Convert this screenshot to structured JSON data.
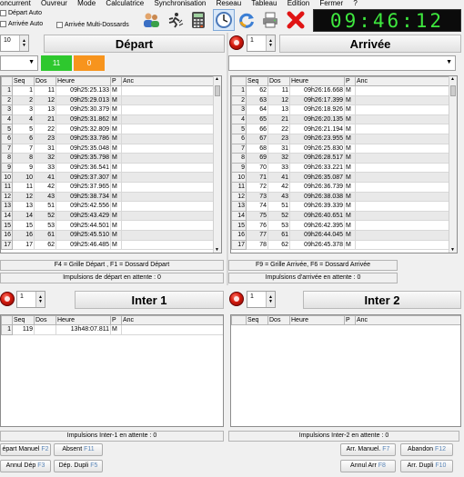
{
  "menu": [
    "oncurrent",
    "Ouvreur",
    "Mode",
    "Calculatrice",
    "Synchronisation",
    "Reseau",
    "Tableau",
    "Edition",
    "Fermer",
    "?"
  ],
  "toolbar": {
    "depart_auto": "Départ Auto",
    "arrivee_auto": "Arrivée Auto",
    "multi_dossards": "Arrivée Multi-Dossards",
    "clock": "09:46:12"
  },
  "depart": {
    "spin": "10",
    "title": "Départ",
    "badge_green": "11",
    "badge_orange": "0",
    "columns": [
      "Seq",
      "Dos",
      "Heure",
      "P",
      "Anc"
    ],
    "rows": [
      [
        "1",
        "1",
        "11",
        "09h25:25.133",
        "M"
      ],
      [
        "2",
        "2",
        "12",
        "09h25:29.013",
        "M"
      ],
      [
        "3",
        "3",
        "13",
        "09h25:30.379",
        "M"
      ],
      [
        "4",
        "4",
        "21",
        "09h25:31.862",
        "M"
      ],
      [
        "5",
        "5",
        "22",
        "09h25:32.809",
        "M"
      ],
      [
        "6",
        "6",
        "23",
        "09h25:33.786",
        "M"
      ],
      [
        "7",
        "7",
        "31",
        "09h25:35.048",
        "M"
      ],
      [
        "8",
        "8",
        "32",
        "09h25:35.798",
        "M"
      ],
      [
        "9",
        "9",
        "33",
        "09h25:36.541",
        "M"
      ],
      [
        "10",
        "10",
        "41",
        "09h25:37.307",
        "M"
      ],
      [
        "11",
        "11",
        "42",
        "09h25:37.965",
        "M"
      ],
      [
        "12",
        "12",
        "43",
        "09h25:38.734",
        "M"
      ],
      [
        "13",
        "13",
        "51",
        "09h25:42.556",
        "M"
      ],
      [
        "14",
        "14",
        "52",
        "09h25:43.429",
        "M"
      ],
      [
        "15",
        "15",
        "53",
        "09h25:44.501",
        "M"
      ],
      [
        "16",
        "16",
        "61",
        "09h25:45.510",
        "M"
      ],
      [
        "17",
        "17",
        "62",
        "09h25:46.485",
        "M"
      ]
    ],
    "hint": "F4 = Grille Départ , F1 = Dossard Départ",
    "pending": "Impulsions de départ en attente : 0"
  },
  "arrivee": {
    "spin": "1",
    "title": "Arrivée",
    "columns": [
      "Seq",
      "Dos",
      "Heure",
      "P",
      "Anc"
    ],
    "rows": [
      [
        "1",
        "62",
        "11",
        "09h26:16.668",
        "M"
      ],
      [
        "2",
        "63",
        "12",
        "09h26:17.399",
        "M"
      ],
      [
        "3",
        "64",
        "13",
        "09h26:18.926",
        "M"
      ],
      [
        "4",
        "65",
        "21",
        "09h26:20.135",
        "M"
      ],
      [
        "5",
        "66",
        "22",
        "09h26:21.194",
        "M"
      ],
      [
        "6",
        "67",
        "23",
        "09h26:23.955",
        "M"
      ],
      [
        "7",
        "68",
        "31",
        "09h26:25.830",
        "M"
      ],
      [
        "8",
        "69",
        "32",
        "09h26:28.517",
        "M"
      ],
      [
        "9",
        "70",
        "33",
        "09h26:33.221",
        "M"
      ],
      [
        "10",
        "71",
        "41",
        "09h26:35.087",
        "M"
      ],
      [
        "11",
        "72",
        "42",
        "09h26:36.739",
        "M"
      ],
      [
        "12",
        "73",
        "43",
        "09h26:38.038",
        "M"
      ],
      [
        "13",
        "74",
        "51",
        "09h26:39.339",
        "M"
      ],
      [
        "14",
        "75",
        "52",
        "09h26:40.651",
        "M"
      ],
      [
        "15",
        "76",
        "53",
        "09h26:42.395",
        "M"
      ],
      [
        "16",
        "77",
        "61",
        "09h26:44.045",
        "M"
      ],
      [
        "17",
        "78",
        "62",
        "09h26:45.378",
        "M"
      ]
    ],
    "hint": "F9 = Grille Arrivée, F6 = Dossard Arrivée",
    "pending": "Impulsions d'arrivée en attente : 0"
  },
  "inter1": {
    "spin": "1",
    "title": "Inter 1",
    "columns": [
      "Seq",
      "Dos",
      "Heure",
      "P",
      "Anc"
    ],
    "rows": [
      [
        "1",
        "119",
        "",
        "13h48:07.811",
        "M"
      ]
    ],
    "pending": "Impulsions Inter-1 en attente : 0"
  },
  "inter2": {
    "spin": "1",
    "title": "Inter 2",
    "columns": [
      "Seq",
      "Dos",
      "Heure",
      "P",
      "Anc"
    ],
    "pending": "Impulsions Inter-2 en attente : 0"
  },
  "buttons": {
    "depart_manuel": "épart Manuel",
    "depart_manuel_key": "F2",
    "absent": "Absent",
    "absent_key": "F11",
    "annul_dep": "Annul Dép",
    "annul_dep_key": "F3",
    "dep_dupli": "Dép. Dupli",
    "dep_dupli_key": "F5",
    "arr_manuel": "Arr. Manuel.",
    "arr_manuel_key": "F7",
    "abandon": "Abandon",
    "abandon_key": "F12",
    "annul_arr": "Annul Arr",
    "annul_arr_key": "F8",
    "arr_dupli": "Arr. Dupli",
    "arr_dupli_key": "F10"
  },
  "colors": {
    "green_badge": "#2ec82e",
    "orange_badge": "#f7941d",
    "clock_digits": "#3ee83e",
    "selection": "#b7d2ef"
  }
}
